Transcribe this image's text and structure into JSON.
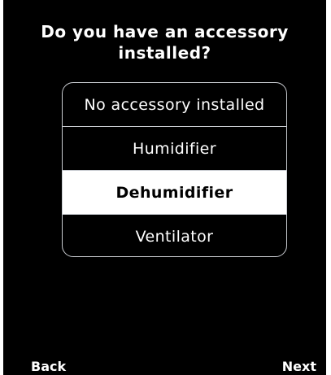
{
  "prompt": {
    "title_line1": "Do you have an accessory",
    "title_line2": "installed?"
  },
  "options": [
    {
      "label": "No accessory installed",
      "selected": false
    },
    {
      "label": "Humidifier",
      "selected": false
    },
    {
      "label": "Dehumidifier",
      "selected": true
    },
    {
      "label": "Ventilator",
      "selected": false
    }
  ],
  "footer": {
    "back_label": "Back",
    "next_label": "Next"
  },
  "colors": {
    "background": "#000000",
    "text": "#ffffff",
    "selected_background": "#ffffff",
    "selected_text": "#000000",
    "border": "#c9ccd1"
  }
}
